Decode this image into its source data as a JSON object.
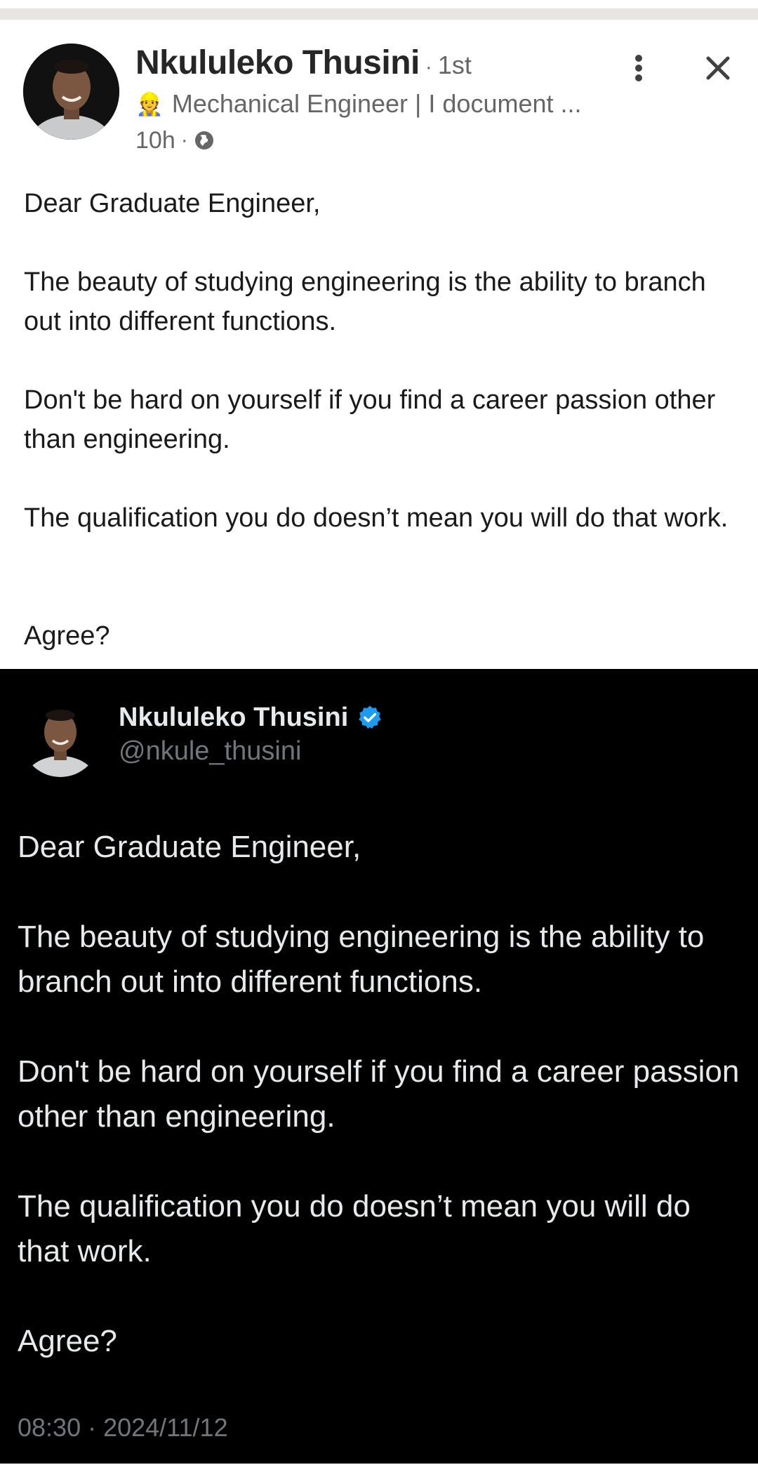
{
  "linkedin_post": {
    "author_name": "Nkululeko Thusini",
    "degree": "1st",
    "headline_emoji": "👷",
    "headline": "Mechanical Engineer | I document ...",
    "time": "10h",
    "visibility_icon": "globe-icon",
    "more_icon": "more-vertical-icon",
    "close_icon": "close-icon",
    "paragraphs": [
      "Dear Graduate Engineer,",
      "The beauty of studying engineering is the ability to branch out into different functions.",
      "Don't be hard on yourself if you find a career passion other than engineering.",
      "The qualification you do doesn’t mean you will do that work.",
      "Agree?"
    ]
  },
  "tweet": {
    "author_name": "Nkululeko Thusini",
    "verified_icon": "verified-badge-icon",
    "verified_color": "#1d9bf0",
    "handle": "@nkule_thusini",
    "paragraphs": [
      "Dear Graduate Engineer,",
      "The beauty of studying engineering is the ability to branch out into different functions.",
      "Don't be hard on yourself if you find a career passion other than engineering.",
      "The qualification you do doesn’t mean you will do that work.",
      "Agree?"
    ],
    "timestamp": "08:30 · 2024/11/12"
  }
}
